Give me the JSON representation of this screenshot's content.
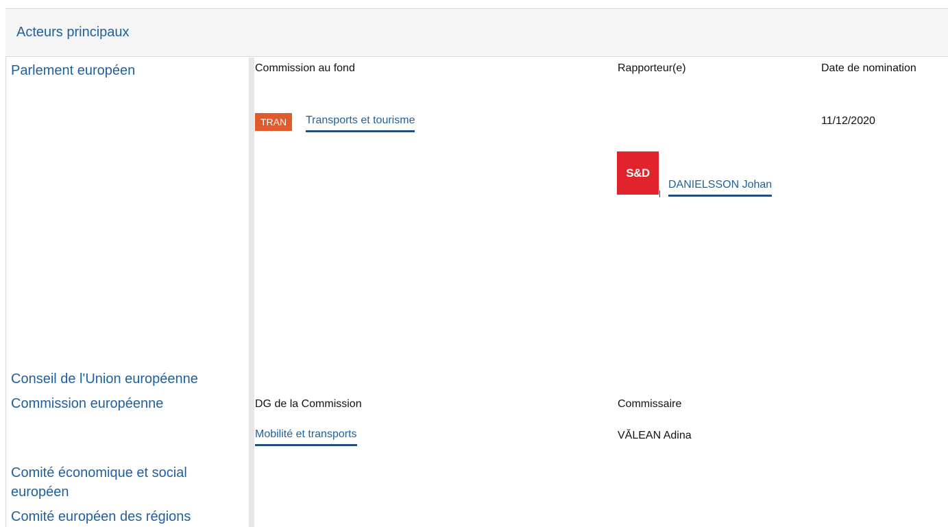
{
  "section": {
    "title": "Acteurs principaux"
  },
  "actors": {
    "ep": "Parlement européen",
    "council": "Conseil de l'Union européenne",
    "commission": "Commission européenne",
    "eesc_line1": "Comité économique et social",
    "eesc_line2": "européen",
    "cor": "Comité européen des régions"
  },
  "parliament": {
    "col_committee": "Commission au fond",
    "col_rapporteur": "Rapporteur(e)",
    "col_date": "Date de nomination",
    "committee": {
      "code": "TRAN",
      "name": "Transports et tourisme",
      "date": "11/12/2020"
    },
    "rapporteur": {
      "group_logo": "S&D",
      "name": "DANIELSSON Johan"
    }
  },
  "commission": {
    "col_dg": "DG de la Commission",
    "col_commissioner": "Commissaire",
    "dg": "Mobilité et transports",
    "commissioner": "VĂLEAN Adina"
  },
  "colors": {
    "link": "#1f5f9f",
    "badge": "#e05a2b",
    "party": "#e1232b"
  }
}
